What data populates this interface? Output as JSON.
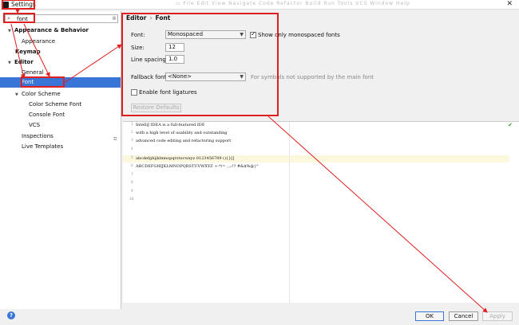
{
  "window": {
    "title": "Settings",
    "ghost_text": "▭  File  Edit  View  Navigate  Code  Refactor  Build  Run  Tools  VCS  Window  Help"
  },
  "search": {
    "value": "font"
  },
  "tree": {
    "appearance_behavior": "Appearance & Behavior",
    "appearance": "Appearance",
    "keymap": "Keymap",
    "editor": "Editor",
    "general": "General",
    "font": "Font",
    "color_scheme": "Color Scheme",
    "color_scheme_font": "Color Scheme Font",
    "console_font": "Console Font",
    "vcs": "VCS",
    "inspections": "Inspections",
    "live_templates": "Live Templates"
  },
  "breadcrumb": {
    "parent": "Editor",
    "separator": "›",
    "current": "Font"
  },
  "form": {
    "font_label": "Font:",
    "font_value": "Monospaced",
    "monospaced_only_label": "Show only monospaced fonts",
    "monospaced_only_checked": true,
    "size_label": "Size:",
    "size_value": "12",
    "line_spacing_label": "Line spacing:",
    "line_spacing_value": "1.0",
    "fallback_label": "Fallback font:",
    "fallback_value": "<None>",
    "fallback_hint": "For symbols not supported by the main font",
    "ligatures_label": "Enable font ligatures",
    "ligatures_checked": false,
    "restore_defaults": "Restore Defaults"
  },
  "preview": {
    "line_numbers": [
      "1",
      "2",
      "3",
      "4",
      "5",
      "6",
      "7",
      "8",
      "9",
      "10"
    ],
    "lines": [
      "IntelliJ IDEA is a full-featured IDE",
      "with a high level of usability and outstanding",
      "advanced code editing and refactoring support",
      "",
      "abcdefghijklmnopqrstuvwxyz 0123456789 (){}[]",
      "ABCDEFGHIJKLMNOPQRSTUVWXYZ +-*/= .,;:!? #&$%@|^",
      "",
      "",
      "",
      ""
    ]
  },
  "buttons": {
    "help": "?",
    "ok": "OK",
    "cancel": "Cancel",
    "apply": "Apply"
  },
  "colors": {
    "selection": "#3875d7",
    "annotation": "#e02020"
  }
}
